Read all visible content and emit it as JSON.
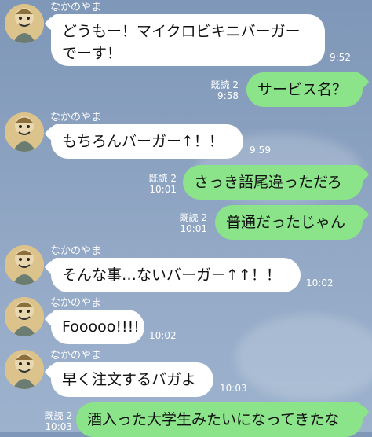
{
  "chat": {
    "messages": [
      {
        "sender": "なかのやま",
        "text_lines": [
          "どうもー！マイクロビキニバーガー",
          "でーす！"
        ],
        "time": "9:52",
        "direction": "in"
      },
      {
        "text": "サービス名？",
        "read": "既読 2",
        "time": "9:58",
        "direction": "out"
      },
      {
        "sender": "なかのやま",
        "text": "もちろんバーガー↑！！",
        "time": "9:59",
        "direction": "in"
      },
      {
        "text": "さっき語尾違っただろ",
        "read": "既読 2",
        "time": "10:01",
        "direction": "out"
      },
      {
        "text": "普通だったじゃん",
        "read": "既読 2",
        "time": "10:01",
        "direction": "out"
      },
      {
        "sender": "なかのやま",
        "text": "そんな事…ないバーガー↑↑！！",
        "time": "10:02",
        "direction": "in"
      },
      {
        "sender": "なかのやま",
        "text": "Fooooo!!!!",
        "time": "10:02",
        "direction": "in"
      },
      {
        "sender": "なかのやま",
        "text": "早く注文するバガよ",
        "time": "10:03",
        "direction": "in"
      },
      {
        "text": "酒入った大学生みたいになってきたな",
        "read": "既読 2",
        "time": "10:03",
        "direction": "out"
      }
    ]
  },
  "colors": {
    "background": "#8aa1c0",
    "incoming_bubble": "#ffffff",
    "outgoing_bubble": "#8be38a",
    "meta_text": "#ffffff"
  },
  "icons": {
    "avatar": "avatar-icon"
  }
}
